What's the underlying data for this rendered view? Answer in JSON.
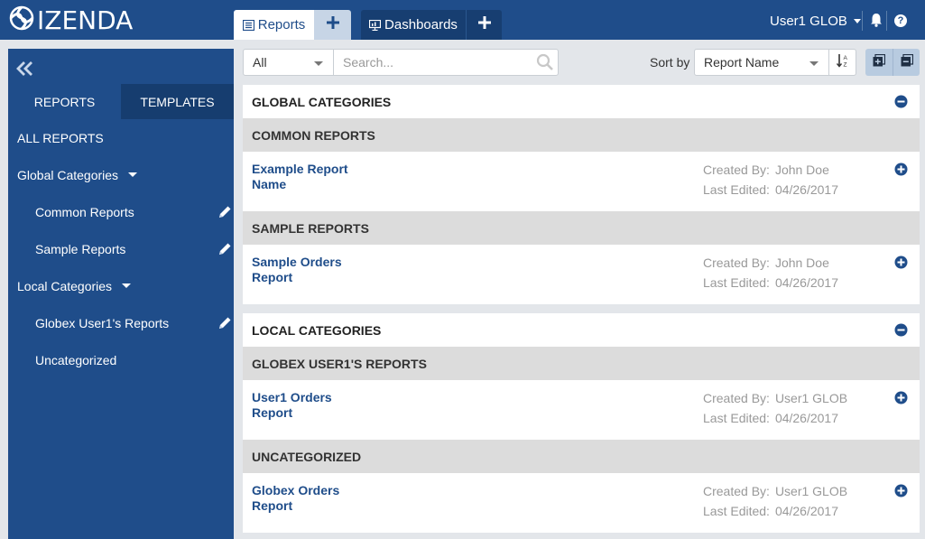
{
  "brand": {
    "name": "IZENDA"
  },
  "top_tabs": {
    "reports_label": "Reports",
    "dashboards_label": "Dashboards"
  },
  "user": {
    "name": "User1 GLOB"
  },
  "help_glyph": "?",
  "sidebar": {
    "tabs": {
      "reports": "REPORTS",
      "templates": "TEMPLATES"
    },
    "items": [
      {
        "label": "ALL REPORTS"
      },
      {
        "label": "Global Categories"
      },
      {
        "label": "Common Reports"
      },
      {
        "label": "Sample Reports"
      },
      {
        "label": "Local Categories"
      },
      {
        "label": "Globex User1's Reports"
      },
      {
        "label": "Uncategorized"
      }
    ]
  },
  "toolbar": {
    "filter_value": "All",
    "search_placeholder": "Search...",
    "sort_label": "Sort by",
    "sort_value": "Report Name"
  },
  "content": {
    "created_by_label": "Created By:",
    "last_edited_label": "Last Edited:",
    "groups": [
      {
        "title": "GLOBAL CATEGORIES",
        "categories": [
          {
            "title": "COMMON REPORTS",
            "report": {
              "name_line1": "Example Report",
              "name_line2": "Name",
              "created_by": "John Doe",
              "last_edited": "04/26/2017"
            }
          },
          {
            "title": "SAMPLE REPORTS",
            "report": {
              "name_line1": "Sample Orders",
              "name_line2": "Report",
              "created_by": "John Doe",
              "last_edited": "04/26/2017"
            }
          }
        ]
      },
      {
        "title": "LOCAL CATEGORIES",
        "categories": [
          {
            "title": "GLOBEX USER1'S REPORTS",
            "report": {
              "name_line1": "User1 Orders",
              "name_line2": "Report",
              "created_by": "User1 GLOB",
              "last_edited": "04/26/2017"
            }
          },
          {
            "title": "UNCATEGORIZED",
            "report": {
              "name_line1": "Globex Orders",
              "name_line2": "Report",
              "created_by": "User1 GLOB",
              "last_edited": "04/26/2017"
            }
          }
        ]
      }
    ]
  },
  "colors": {
    "brand_blue": "#1f4d8a",
    "sidebar_tab_dark": "#163d6f",
    "category_header_gray": "#dcdcdc"
  }
}
